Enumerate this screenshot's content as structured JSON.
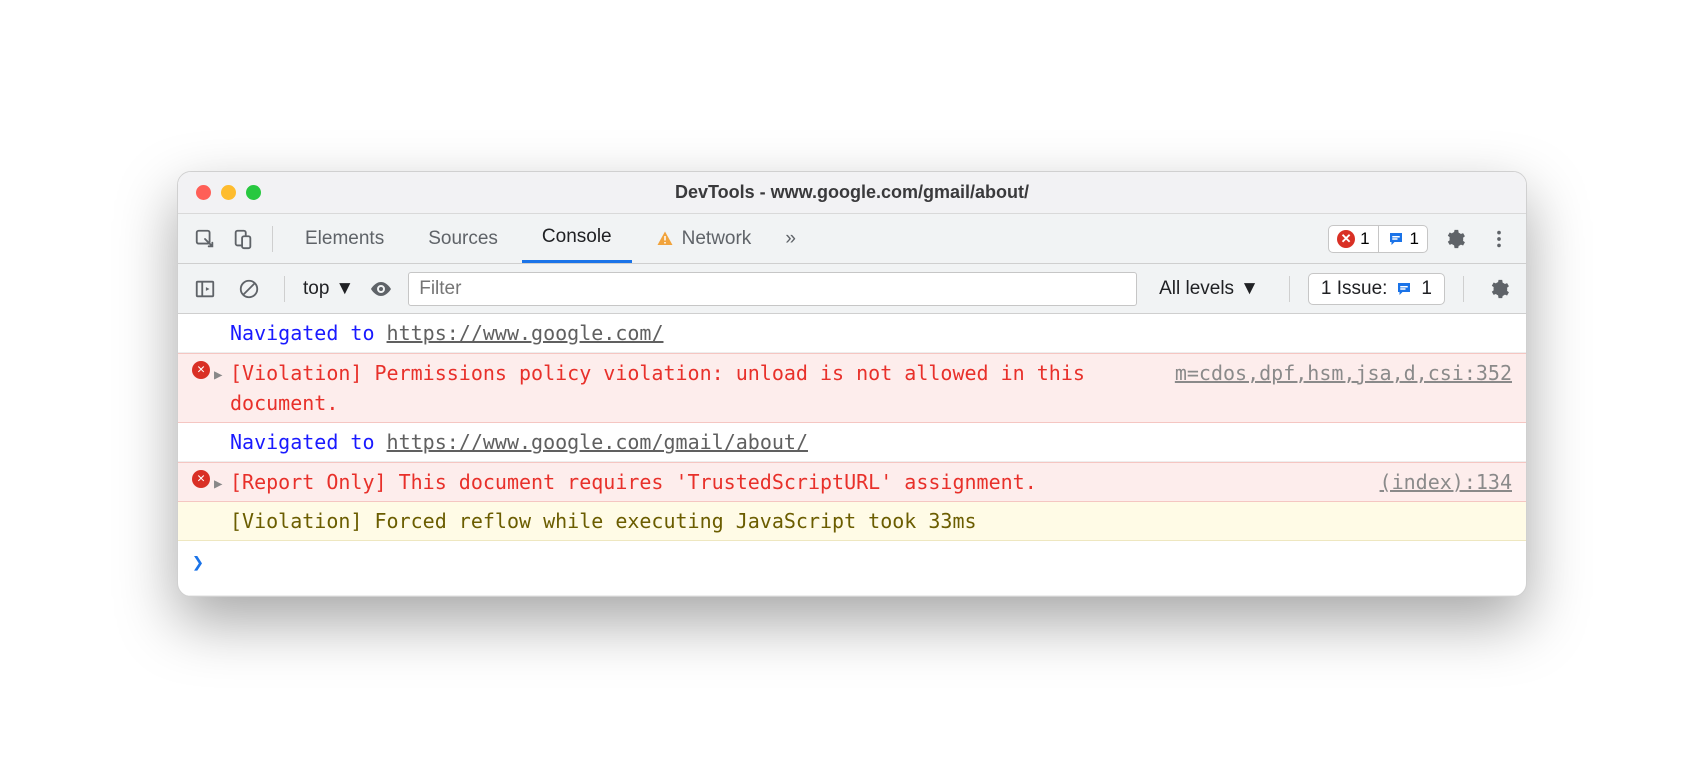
{
  "title": "DevTools - www.google.com/gmail/about/",
  "tabs": {
    "elements": "Elements",
    "sources": "Sources",
    "console": "Console",
    "network": "Network",
    "more": "»"
  },
  "badges": {
    "errors": "1",
    "messages": "1"
  },
  "toolbar": {
    "context": "top",
    "filter_placeholder": "Filter",
    "levels": "All levels",
    "issue_label": "1 Issue:",
    "issue_count": "1"
  },
  "log": [
    {
      "type": "nav",
      "prefix": "Navigated to ",
      "url": "https://www.google.com/"
    },
    {
      "type": "error",
      "text": "[Violation] Permissions policy violation: unload is not allowed in this document.",
      "src": "m=cdos,dpf,hsm,jsa,d,csi:352"
    },
    {
      "type": "nav",
      "prefix": "Navigated to ",
      "url": "https://www.google.com/gmail/about/"
    },
    {
      "type": "error",
      "text": "[Report Only] This document requires 'TrustedScriptURL' assignment.",
      "src": "(index):134"
    },
    {
      "type": "warn",
      "text": "[Violation] Forced reflow while executing JavaScript took 33ms"
    }
  ],
  "prompt": "❯"
}
